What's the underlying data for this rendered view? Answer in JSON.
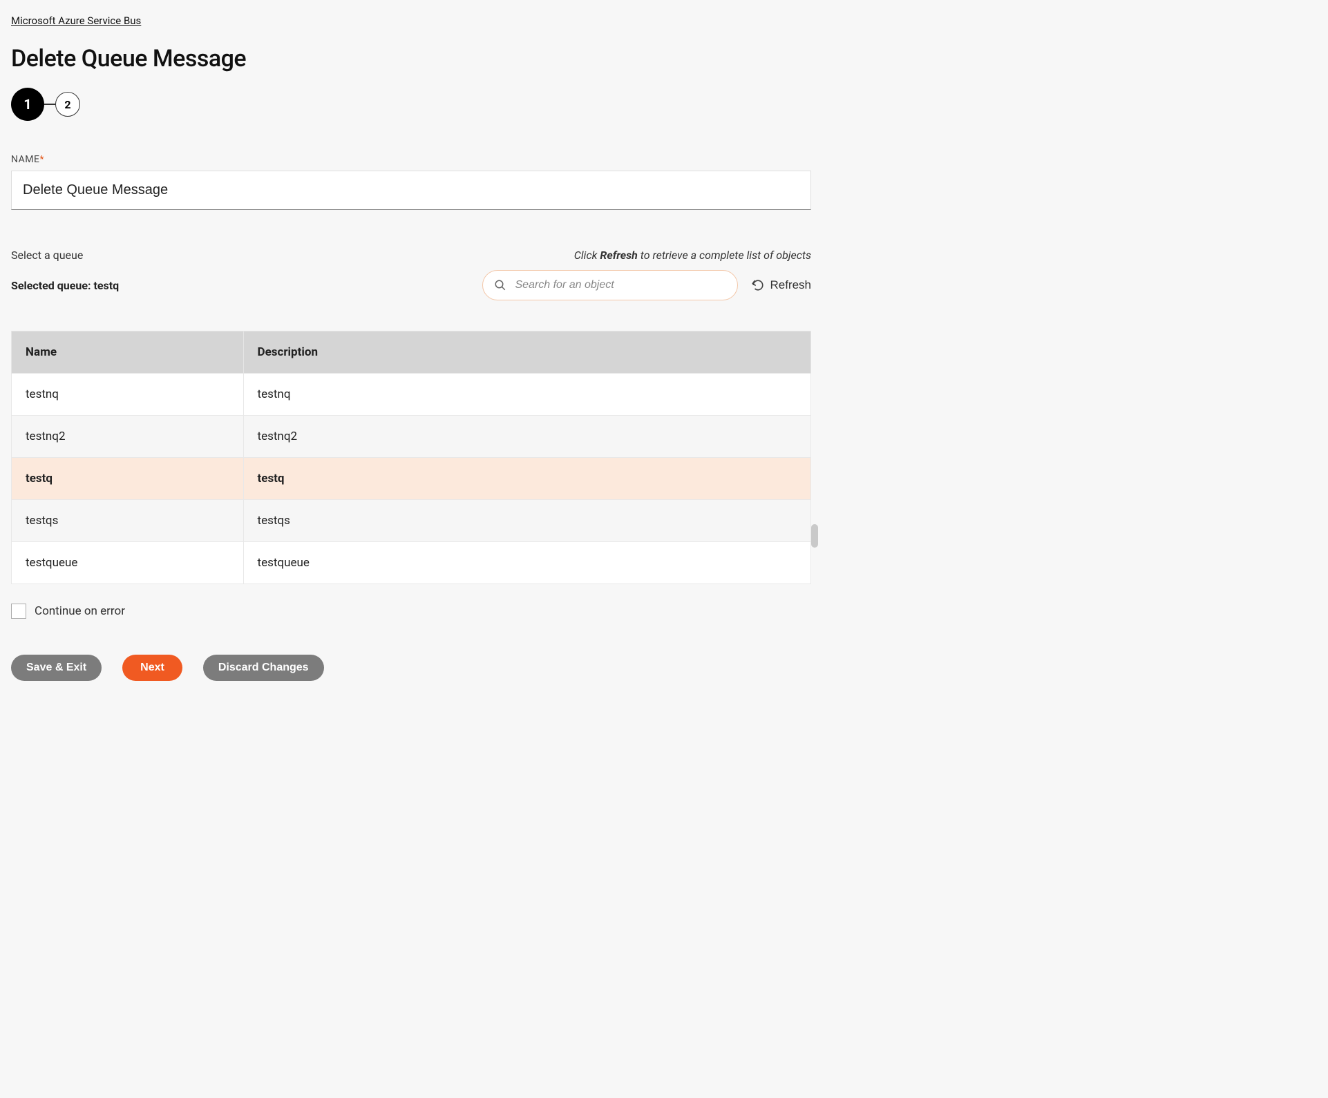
{
  "breadcrumb": {
    "label": "Microsoft Azure Service Bus"
  },
  "page": {
    "title": "Delete Queue Message"
  },
  "stepper": {
    "step1": "1",
    "step2": "2"
  },
  "form": {
    "name_label": "NAME",
    "name_required": "*",
    "name_value": "Delete Queue Message"
  },
  "queue_section": {
    "select_label": "Select a queue",
    "refresh_hint_prefix": "Click ",
    "refresh_hint_bold": "Refresh",
    "refresh_hint_suffix": " to retrieve a complete list of objects",
    "selected_label_prefix": "Selected queue: ",
    "selected_value": "testq",
    "search_placeholder": "Search for an object",
    "refresh_button": "Refresh"
  },
  "table": {
    "headers": {
      "name": "Name",
      "description": "Description"
    },
    "rows": [
      {
        "name": "testnq",
        "description": "testnq",
        "selected": false
      },
      {
        "name": "testnq2",
        "description": "testnq2",
        "selected": false
      },
      {
        "name": "testq",
        "description": "testq",
        "selected": true
      },
      {
        "name": "testqs",
        "description": "testqs",
        "selected": false
      },
      {
        "name": "testqueue",
        "description": "testqueue",
        "selected": false
      }
    ]
  },
  "options": {
    "continue_on_error_label": "Continue on error",
    "continue_on_error_checked": false
  },
  "actions": {
    "save_exit": "Save & Exit",
    "next": "Next",
    "discard": "Discard Changes"
  }
}
